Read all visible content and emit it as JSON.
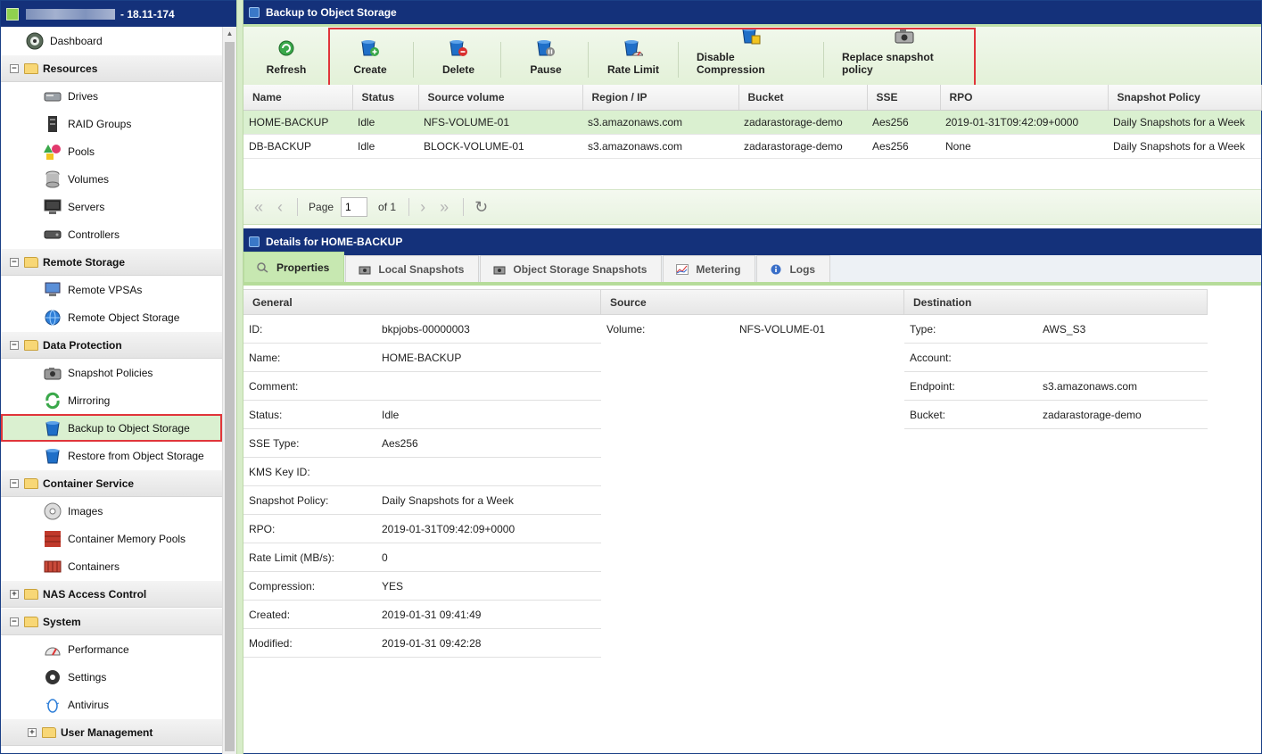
{
  "sidebar": {
    "header_version": "- 18.11-174",
    "dashboard": "Dashboard",
    "resources": "Resources",
    "drives": "Drives",
    "raid_groups": "RAID Groups",
    "pools": "Pools",
    "volumes": "Volumes",
    "servers": "Servers",
    "controllers": "Controllers",
    "remote_storage": "Remote Storage",
    "remote_vpsas": "Remote VPSAs",
    "remote_object_storage": "Remote Object Storage",
    "data_protection": "Data Protection",
    "snapshot_policies": "Snapshot Policies",
    "mirroring": "Mirroring",
    "backup_to_object_storage": "Backup to Object Storage",
    "restore_from_object_storage": "Restore from Object Storage",
    "container_service": "Container Service",
    "images": "Images",
    "container_memory_pools": "Container Memory Pools",
    "containers": "Containers",
    "nas_access_control": "NAS Access Control",
    "system": "System",
    "performance": "Performance",
    "settings": "Settings",
    "antivirus": "Antivirus",
    "user_management": "User Management"
  },
  "main": {
    "title": "Backup to Object Storage",
    "toolbar": {
      "refresh": "Refresh",
      "create": "Create",
      "delete": "Delete",
      "pause": "Pause",
      "rate_limit": "Rate Limit",
      "disable_compression": "Disable Compression",
      "replace_snapshot_policy": "Replace snapshot policy"
    },
    "columns": [
      "Name",
      "Status",
      "Source volume",
      "Region / IP",
      "Bucket",
      "SSE",
      "RPO",
      "Snapshot Policy"
    ],
    "rows": [
      [
        "HOME-BACKUP",
        "Idle",
        "NFS-VOLUME-01",
        "s3.amazonaws.com",
        "zadarastorage-demo",
        "Aes256",
        "2019-01-31T09:42:09+0000",
        "Daily Snapshots for a Week"
      ],
      [
        "DB-BACKUP",
        "Idle",
        "BLOCK-VOLUME-01",
        "s3.amazonaws.com",
        "zadarastorage-demo",
        "Aes256",
        "None",
        "Daily Snapshots for a Week"
      ]
    ],
    "pager": {
      "page_label": "Page",
      "page_value": "1",
      "of_label": "of 1"
    }
  },
  "details": {
    "title": "Details for HOME-BACKUP",
    "tabs": {
      "properties": "Properties",
      "local_snapshots": "Local Snapshots",
      "object_storage_snapshots": "Object Storage Snapshots",
      "metering": "Metering",
      "logs": "Logs"
    },
    "general": {
      "header": "General",
      "fields": [
        {
          "k": "ID:",
          "v": "bkpjobs-00000003"
        },
        {
          "k": "Name:",
          "v": "HOME-BACKUP"
        },
        {
          "k": "Comment:",
          "v": ""
        },
        {
          "k": "Status:",
          "v": "Idle"
        },
        {
          "k": "SSE Type:",
          "v": "Aes256"
        },
        {
          "k": "KMS Key ID:",
          "v": ""
        },
        {
          "k": "Snapshot Policy:",
          "v": "Daily Snapshots for a Week"
        },
        {
          "k": "RPO:",
          "v": "2019-01-31T09:42:09+0000"
        },
        {
          "k": "Rate Limit (MB/s):",
          "v": "0"
        },
        {
          "k": "Compression:",
          "v": "YES"
        },
        {
          "k": "Created:",
          "v": "2019-01-31 09:41:49"
        },
        {
          "k": "Modified:",
          "v": "2019-01-31 09:42:28"
        }
      ]
    },
    "source": {
      "header": "Source",
      "fields": [
        {
          "k": "Volume:",
          "v": "NFS-VOLUME-01"
        }
      ]
    },
    "destination": {
      "header": "Destination",
      "fields": [
        {
          "k": "Type:",
          "v": "AWS_S3"
        },
        {
          "k": "Account:",
          "v": ""
        },
        {
          "k": "Endpoint:",
          "v": "s3.amazonaws.com"
        },
        {
          "k": "Bucket:",
          "v": "zadarastorage-demo"
        }
      ]
    }
  },
  "colors": {
    "header_navy": "#14317a",
    "selection_green": "#daf0d0",
    "highlight_red": "#e0353a"
  }
}
